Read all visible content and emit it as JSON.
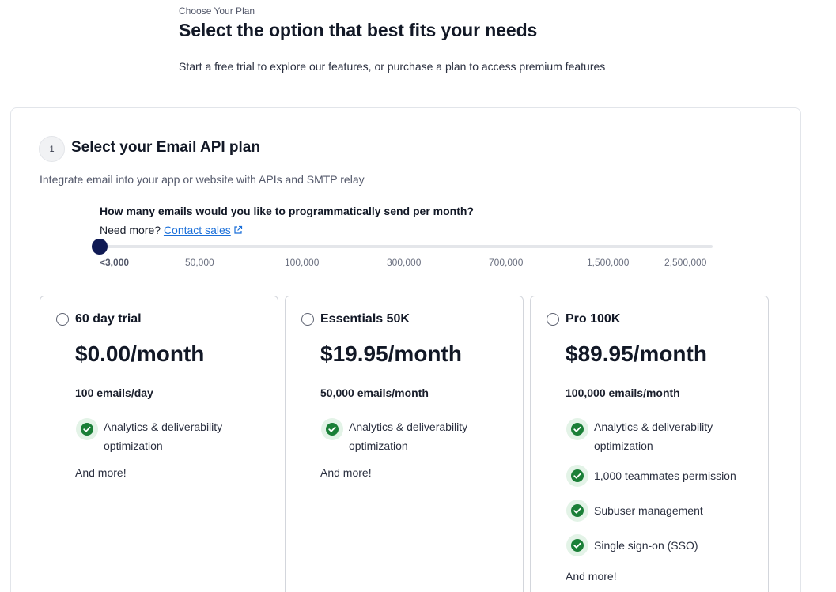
{
  "header": {
    "eyebrow": "Choose Your Plan",
    "title": "Select the option that best fits your needs",
    "subtitle": "Start a free trial to explore our features, or purchase a plan to access premium features"
  },
  "section": {
    "step_number": "1",
    "title": "Select your Email API plan",
    "subtitle": "Integrate email into your app or website with APIs and SMTP relay"
  },
  "slider": {
    "question": "How many emails would you like to programmatically send per month?",
    "need_more_label": "Need more?",
    "contact_label": "Contact sales",
    "ticks": [
      "<3,000",
      "50,000",
      "100,000",
      "300,000",
      "700,000",
      "1,500,000",
      "2,500,000"
    ],
    "selected_index": 0,
    "accent_color": "#0f1a54"
  },
  "plans": [
    {
      "name": "60 day trial",
      "price": "$0.00/month",
      "quota": "100 emails/day",
      "features": [
        "Analytics & deliverability optimization"
      ],
      "more": "And more!"
    },
    {
      "name": "Essentials 50K",
      "price": "$19.95/month",
      "quota": "50,000 emails/month",
      "features": [
        "Analytics & deliverability optimization"
      ],
      "more": "And more!"
    },
    {
      "name": "Pro 100K",
      "price": "$89.95/month",
      "quota": "100,000 emails/month",
      "features": [
        "Analytics & deliverability optimization",
        "1,000 teammates permission",
        "Subuser management",
        "Single sign-on (SSO)"
      ],
      "more": "And more!"
    }
  ],
  "colors": {
    "check_green": "#1a7f37",
    "check_bg": "#e3f3e7",
    "link_blue": "#1a6fd9"
  },
  "icons": {
    "feature": "check-circle-icon",
    "contact": "external-link-icon",
    "plan_select": "radio-icon"
  }
}
